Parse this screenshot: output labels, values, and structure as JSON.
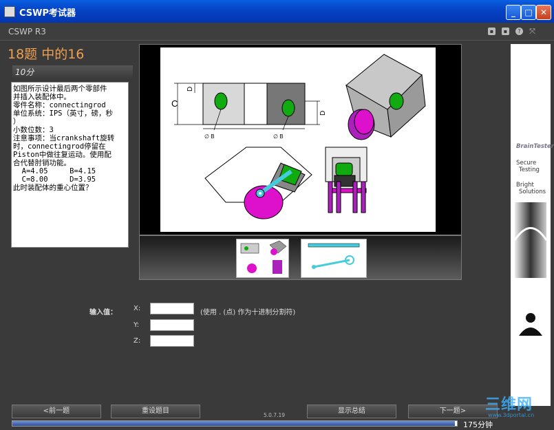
{
  "window": {
    "title": "CSWP考试器",
    "minimize": "_",
    "maximize": "□",
    "close": "✕"
  },
  "appbar": {
    "name": "CSWP R3"
  },
  "question": {
    "title": "18题 中的16",
    "points": "10分",
    "text_lines": [
      "如图所示设计最后两个零部件",
      "并插入装配体中。",
      "零件名称：connectingrod",
      "单位系统：IPS（英寸，磅，秒",
      "）",
      "小数位数：3",
      "注意事项：当crankshaft旋转",
      "时，connectingrod停留在",
      "Piston中做往复运动。使用配",
      "合代替肘销功能。",
      "  A=4.05     B=4.15",
      "  C=8.00     D=3.95",
      "此时装配体的重心位置？"
    ]
  },
  "diagram": {
    "dim_c": "C",
    "dim_d_top": "D",
    "dim_d_right": "D",
    "dim_b_left": "∅ B",
    "dim_b_right": "∅ B"
  },
  "ad": {
    "brand": "BrainTester",
    "line1a": "Secure",
    "line1b": "Testing",
    "line2a": "Bright",
    "line2b": "Solutions"
  },
  "inputs": {
    "label": "输入值：",
    "x_label": "X:",
    "y_label": "Y:",
    "z_label": "Z:",
    "x_value": "",
    "y_value": "",
    "z_value": "",
    "hint": "(使用 . (点) 作为十进制分割符)"
  },
  "buttons": {
    "prev": "<前一题",
    "reset": "重设题目",
    "summary": "显示总结",
    "next": "下一题>"
  },
  "version": "5.0.7.19",
  "timer": "175分钟",
  "progress": 0.996,
  "watermark": "三维网",
  "watermark_sub": "www.3dportal.cn",
  "colors": {
    "accent_orange": "#f0a050",
    "window_blue": "#0542c4",
    "part_green": "#11aa11",
    "part_magenta": "#dd11cc",
    "rod_cyan": "#44ccdd"
  }
}
